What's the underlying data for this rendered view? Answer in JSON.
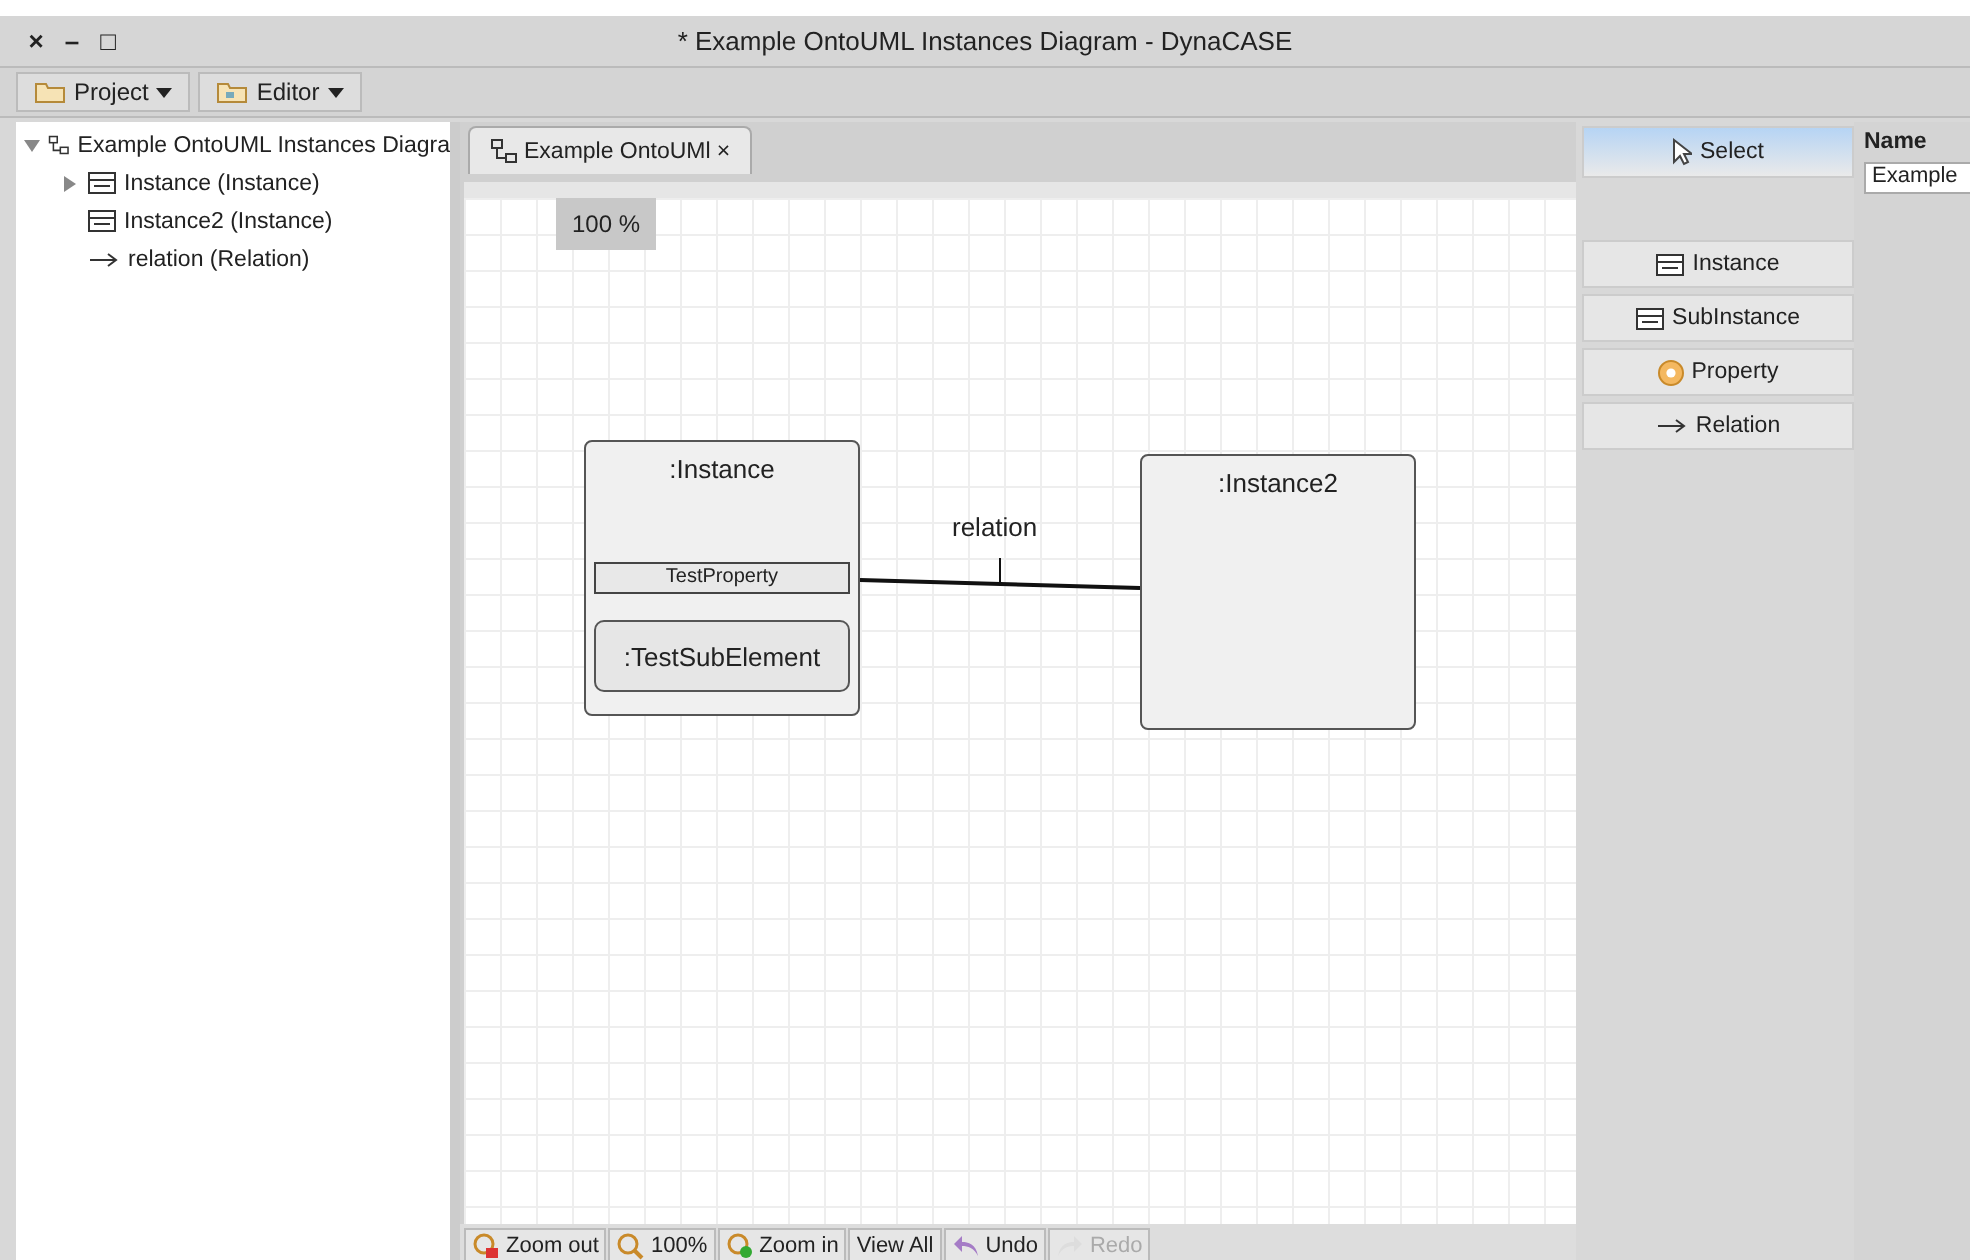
{
  "window": {
    "title": "* Example OntoUML Instances Diagram - DynaCASE",
    "controls": [
      "×",
      "–",
      "□"
    ]
  },
  "toolbar": [
    {
      "label": "Project",
      "kind": "folder"
    },
    {
      "label": "Editor",
      "kind": "editor"
    }
  ],
  "tree": [
    {
      "label": "Example OntoUML Instances Diagra",
      "kind": "diagram",
      "expanded": true,
      "children": [
        {
          "label": "Instance (Instance)",
          "kind": "instance",
          "expanded": false
        },
        {
          "label": "Instance2 (Instance)",
          "kind": "instance"
        },
        {
          "label": "relation (Relation)",
          "kind": "relation"
        }
      ]
    }
  ],
  "editor_tabs": [
    {
      "label": "Example OntoUMl",
      "selected": true,
      "close": "×"
    }
  ],
  "zoom_label": "100 %",
  "diagram": {
    "nodes": [
      {
        "title": ":Instance",
        "property": "TestProperty",
        "sub": ":TestSubElement"
      },
      {
        "title": ":Instance2"
      }
    ],
    "relations": [
      {
        "label": "relation"
      }
    ]
  },
  "palette": [
    {
      "label": "Select",
      "kind": "cursor",
      "selected": true
    },
    {
      "label": "Instance",
      "kind": "instance",
      "selected": false
    },
    {
      "label": "SubInstance",
      "kind": "instance",
      "selected": false
    },
    {
      "label": "Property",
      "kind": "property",
      "selected": false
    },
    {
      "label": "Relation",
      "kind": "relation",
      "selected": false
    }
  ],
  "properties": {
    "label": "Name",
    "value": "Example"
  },
  "bottom_toolbar": [
    {
      "label": "Zoom out",
      "kind": "zoom-out",
      "disabled": false
    },
    {
      "label": "100%",
      "kind": "zoom",
      "disabled": false
    },
    {
      "label": "Zoom in",
      "kind": "zoom-in",
      "disabled": false
    },
    {
      "label": "View All",
      "disabled": false
    },
    {
      "label": "Undo",
      "kind": "undo",
      "disabled": false
    },
    {
      "label": "Redo",
      "kind": "redo",
      "disabled": true
    }
  ]
}
